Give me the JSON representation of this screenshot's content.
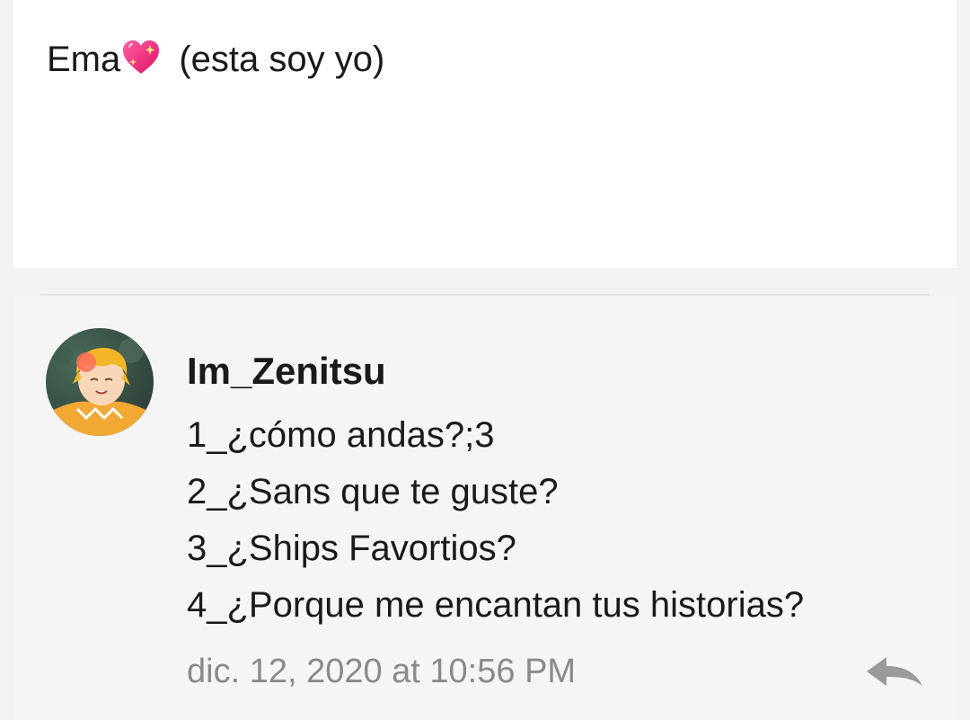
{
  "post": {
    "text_name": "Ema",
    "text_suffix": " (esta soy yo)",
    "emoji": "sparkling-heart-icon"
  },
  "comment": {
    "username": "Im_Zenitsu",
    "lines": [
      "1_¿cómo andas?;3",
      "2_¿Sans que te guste?",
      "3_¿Ships Favortios?",
      "4_¿Porque me encantan tus historias?"
    ],
    "timestamp": "dic. 12, 2020 at 10:56 PM",
    "reply_icon": "reply-arrow-icon"
  },
  "colors": {
    "background": "#f2f2f2",
    "card": "#ffffff",
    "comment_card": "#f5f5f5",
    "text": "#1a1a1a",
    "muted": "#8a8a8a",
    "heart": "#ff3f8e"
  }
}
